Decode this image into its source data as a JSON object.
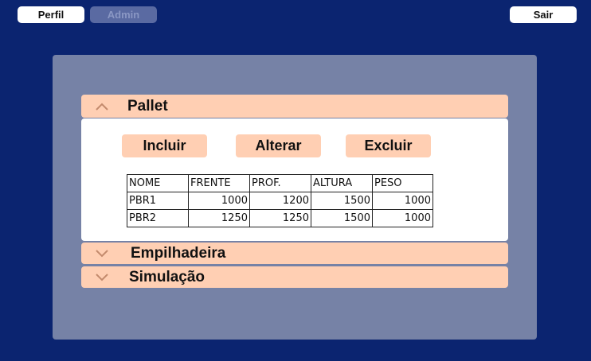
{
  "topbar": {
    "perfil_label": "Perfil",
    "admin_label": "Admin",
    "sair_label": "Sair"
  },
  "accordion": {
    "pallet": {
      "title": "Pallet",
      "expanded": true,
      "actions": {
        "incluir": "Incluir",
        "alterar": "Alterar",
        "excluir": "Excluir"
      },
      "table": {
        "columns": [
          "NOME",
          "FRENTE",
          "PROF.",
          "ALTURA",
          "PESO"
        ],
        "rows": [
          [
            "PBR1",
            "1000",
            "1200",
            "1500",
            "1000"
          ],
          [
            "PBR2",
            "1250",
            "1250",
            "1500",
            "1000"
          ]
        ]
      }
    },
    "empilhadeira": {
      "title": "Empilhadeira",
      "expanded": false
    },
    "simulacao": {
      "title": "Simulação",
      "expanded": false
    }
  },
  "colors": {
    "background": "#0b2470",
    "panel": "#7682a6",
    "accent": "#ffcfb3",
    "admin_disabled": "#5a6aa2"
  },
  "icons": {
    "pallet_toggle": "chevron-up-icon",
    "empilhadeira_toggle": "chevron-down-icon",
    "simulacao_toggle": "chevron-down-icon"
  }
}
